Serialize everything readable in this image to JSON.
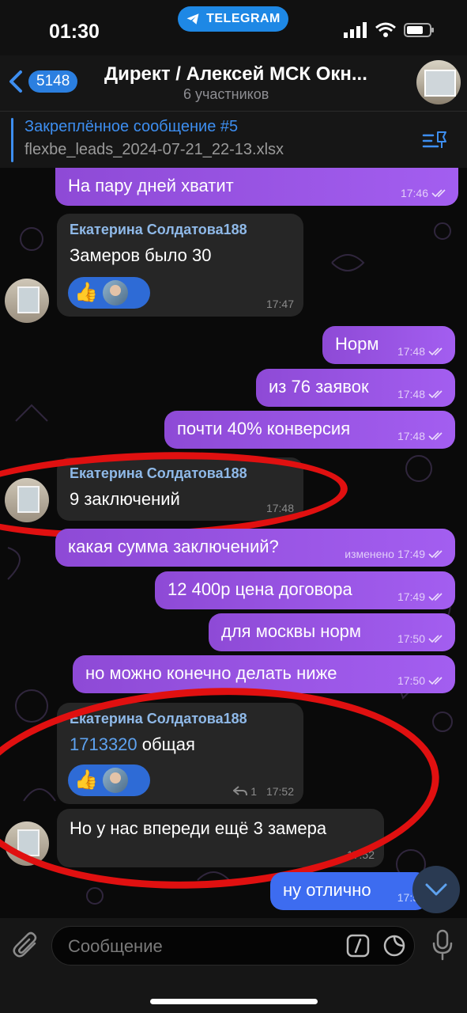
{
  "status": {
    "time": "01:30",
    "app_pill": "TELEGRAM"
  },
  "header": {
    "back_count": "5148",
    "title": "Директ / Алексей МСК Окн...",
    "subtitle": "6 участников"
  },
  "pinned": {
    "title": "Закреплённое сообщение #5",
    "text": "flexbe_leads_2024-07-21_22-13.xlsx"
  },
  "messages": [
    {
      "text": "На пару дней хватит",
      "time": "17:46"
    },
    {
      "sender": "Екатерина Солдатова188",
      "text": "Замеров было 30",
      "time": "17:47",
      "reactions": [
        "👍"
      ]
    },
    {
      "text": "Норм",
      "time": "17:48"
    },
    {
      "text": "из 76 заявок",
      "time": "17:48"
    },
    {
      "text": "почти 40% конверсия",
      "time": "17:48"
    },
    {
      "sender": "Екатерина Солдатова188",
      "text": "9 заключений",
      "time": "17:48"
    },
    {
      "text": "какая сумма заключений?",
      "edited": "изменено",
      "time": "17:49"
    },
    {
      "text": "12 400р цена договора",
      "time": "17:49"
    },
    {
      "text": "для москвы норм",
      "time": "17:50"
    },
    {
      "text": "но можно конечно делать ниже",
      "time": "17:50"
    },
    {
      "sender": "Екатерина Солдатова188",
      "link": "1713320",
      "text": "общая",
      "time": "17:52",
      "replies": "1",
      "reactions": [
        "👍"
      ]
    },
    {
      "text": "Но у нас впереди ещё 3 замера",
      "time": "17:52"
    },
    {
      "text": "ну отлично",
      "time": "17:5"
    }
  ],
  "input": {
    "placeholder": "Сообщение"
  },
  "colors": {
    "outgoing": "#9b55e8",
    "incoming": "#262626",
    "accent": "#3d8ef0",
    "highlight": "#e01010"
  }
}
